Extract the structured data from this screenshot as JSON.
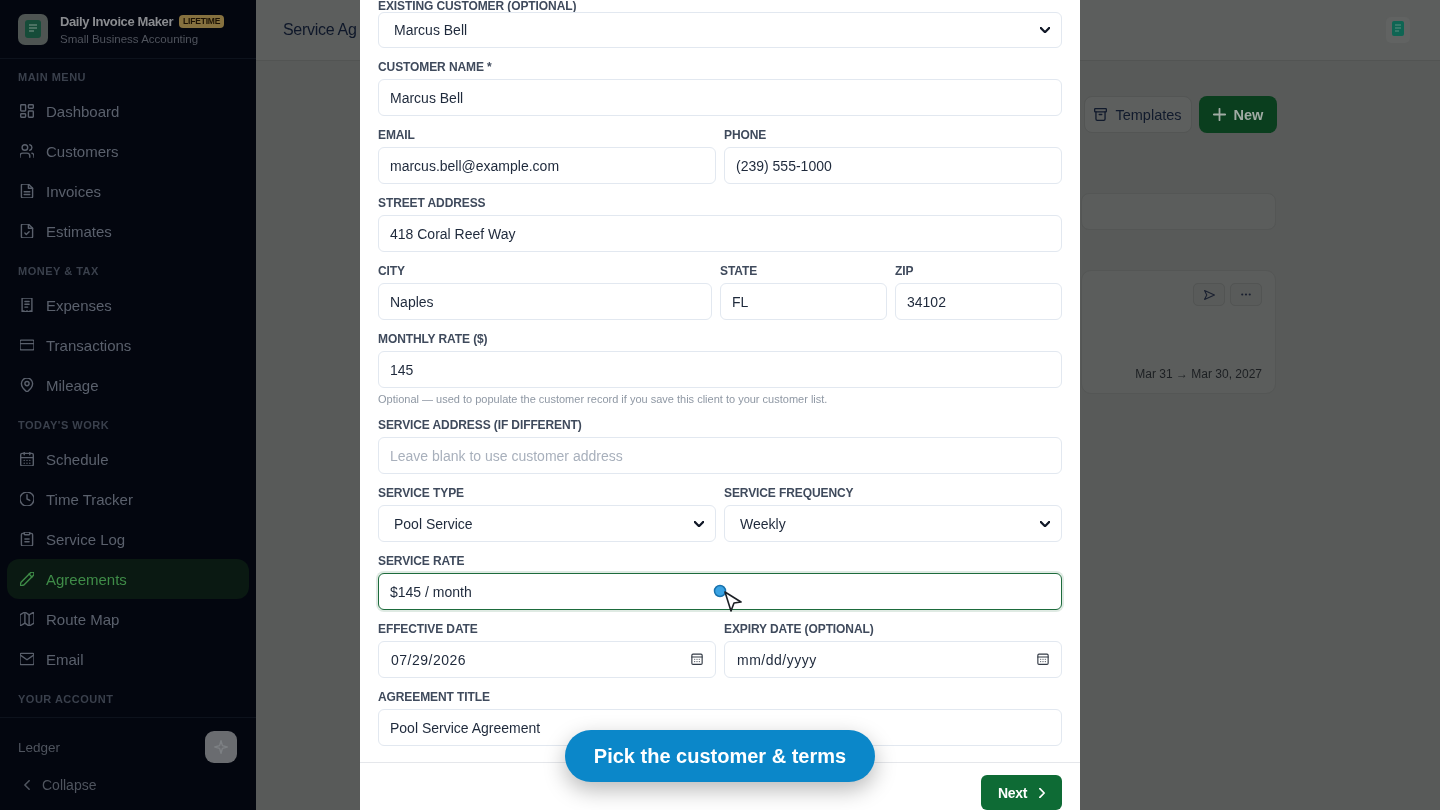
{
  "sidebar": {
    "brand": {
      "name": "Daily Invoice Maker",
      "badge": "LIFETIME",
      "tagline": "Small Business Accounting"
    },
    "sections": [
      {
        "heading": "MAIN MENU",
        "items": [
          {
            "label": "Dashboard",
            "selected": false
          },
          {
            "label": "Customers",
            "selected": false
          },
          {
            "label": "Invoices",
            "selected": false
          },
          {
            "label": "Estimates",
            "selected": false
          }
        ]
      },
      {
        "heading": "MONEY & TAX",
        "items": [
          {
            "label": "Expenses",
            "selected": false
          },
          {
            "label": "Transactions",
            "selected": false
          },
          {
            "label": "Mileage",
            "selected": false
          }
        ]
      },
      {
        "heading": "TODAY'S WORK",
        "items": [
          {
            "label": "Schedule",
            "selected": false
          },
          {
            "label": "Time Tracker",
            "selected": false
          },
          {
            "label": "Service Log",
            "selected": false
          },
          {
            "label": "Agreements",
            "selected": true
          },
          {
            "label": "Route Map",
            "selected": false
          },
          {
            "label": "Email",
            "selected": false
          }
        ]
      },
      {
        "heading": "YOUR ACCOUNT"
      }
    ],
    "footer": {
      "workspace": "Ledger",
      "collapse": "Collapse"
    }
  },
  "page": {
    "title": "Service Ag",
    "actions": [
      {
        "label": "Templates",
        "kind": "secondary"
      },
      {
        "label": "New",
        "kind": "primary"
      }
    ],
    "agreement_card": {
      "date_range": "Mar 31 → Mar 30, 2027"
    }
  },
  "modal": {
    "rows": [
      {
        "fields": [
          {
            "label": "EXISTING CUSTOMER (OPTIONAL)",
            "kind": "select",
            "value": "Marcus Bell",
            "focused": false
          }
        ]
      },
      {
        "fields": [
          {
            "label": "CUSTOMER NAME *",
            "kind": "text",
            "value": "Marcus Bell",
            "focused": false
          }
        ]
      },
      {
        "fields": [
          {
            "label": "EMAIL",
            "kind": "text",
            "value": "marcus.bell@example.com",
            "focused": false
          },
          {
            "label": "PHONE",
            "kind": "text",
            "value": "(239) 555-1000",
            "focused": false
          }
        ]
      },
      {
        "fields": [
          {
            "label": "STREET ADDRESS",
            "kind": "text",
            "value": "418 Coral Reef Way",
            "focused": false
          }
        ]
      },
      {
        "fields": [
          {
            "label": "CITY",
            "kind": "text",
            "value": "Naples",
            "focused": false
          },
          {
            "label": "STATE",
            "kind": "text",
            "value": "FL",
            "focused": false
          },
          {
            "label": "ZIP",
            "kind": "text",
            "value": "34102",
            "focused": false
          }
        ]
      },
      {
        "fields": [
          {
            "label": "MONTHLY RATE ($)",
            "kind": "text",
            "value": "145",
            "focused": false,
            "help": "Optional — used to populate the customer record if you save this client to your customer list."
          }
        ]
      },
      {
        "fields": [
          {
            "label": "SERVICE ADDRESS (IF DIFFERENT)",
            "kind": "text",
            "placeholder": "Leave blank to use customer address",
            "focused": false
          }
        ]
      },
      {
        "fields": [
          {
            "label": "SERVICE TYPE",
            "kind": "select",
            "value": "Pool Service",
            "focused": false
          },
          {
            "label": "SERVICE FREQUENCY",
            "kind": "select",
            "value": "Weekly",
            "focused": false
          }
        ]
      },
      {
        "fields": [
          {
            "label": "SERVICE RATE",
            "kind": "text",
            "value": "$145 / month",
            "focused": true
          }
        ]
      },
      {
        "fields": [
          {
            "label": "EFFECTIVE DATE",
            "kind": "date",
            "value": "07/29/2026",
            "focused": false
          },
          {
            "label": "EXPIRY DATE (OPTIONAL)",
            "kind": "date",
            "placeholder": "mm/dd/yyyy",
            "focused": false
          }
        ]
      },
      {
        "fields": [
          {
            "label": "AGREEMENT TITLE",
            "kind": "text",
            "value": "Pool Service Agreement",
            "focused": false
          }
        ]
      }
    ],
    "coach_tip": "Pick the customer & terms",
    "next": "Next"
  }
}
